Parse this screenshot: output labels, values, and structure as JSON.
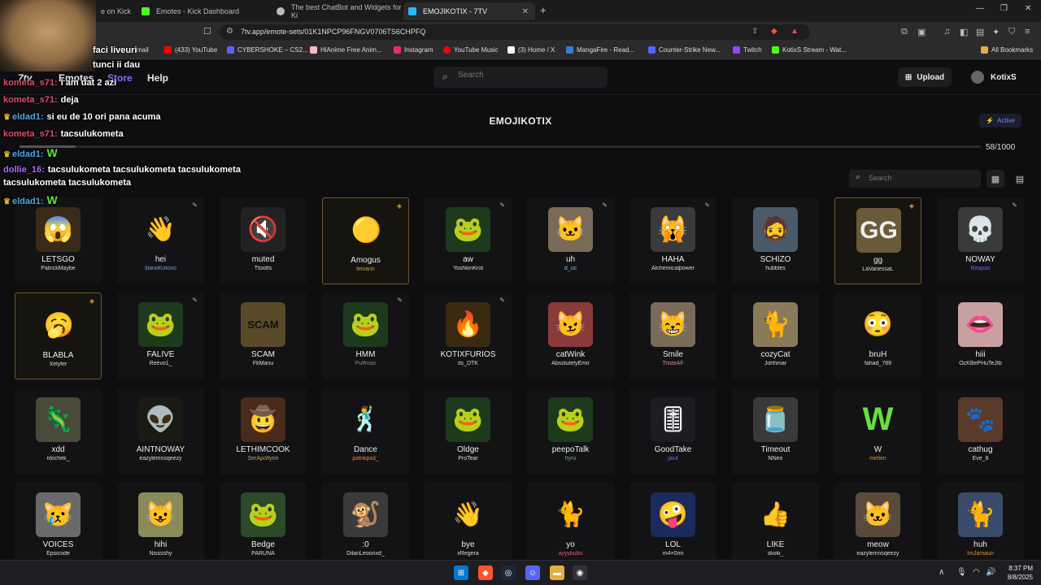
{
  "tabs": [
    {
      "label": "e on Kick",
      "color": "#53fc18"
    },
    {
      "label": "Emotes - Kick Dashboard",
      "color": "#53fc18"
    },
    {
      "label": "The best ChatBot and Widgets for Ki",
      "color": "#bbbbbb"
    },
    {
      "label": "EMOJIKOTIX - 7TV",
      "color": "#29b6f6"
    }
  ],
  "url": "7tv.app/emote-sets/01K1NPCP96FNGV0706TS6CHPFQ",
  "bookmarks": [
    {
      "label": "mail",
      "color": "#888888"
    },
    {
      "label": "(433) YouTube",
      "color": "#ff0000"
    },
    {
      "label": "CYBERSHOKE – CS2...",
      "color": "#5865f2"
    },
    {
      "label": "HiAnime Free Anim...",
      "color": "#ffb6c1"
    },
    {
      "label": "Instagram",
      "color": "#e1306c"
    },
    {
      "label": "YouTube Music",
      "color": "#ff0000"
    },
    {
      "label": "(3) Home / X",
      "color": "#ffffff"
    },
    {
      "label": "MangaFire - Read...",
      "color": "#3a7bd5"
    },
    {
      "label": "Counter-Strike New...",
      "color": "#4b69ff"
    },
    {
      "label": "Twitch",
      "color": "#9146ff"
    },
    {
      "label": "KotixS Stream - Wat...",
      "color": "#53fc18"
    }
  ],
  "all_bookmarks": "All Bookmarks",
  "nav": {
    "logo": "7tv",
    "emotes": "Emotes",
    "store": "Store",
    "help": "Help",
    "search_placeholder": "Search",
    "upload": "Upload",
    "username": "KotixS"
  },
  "set": {
    "title": "EMOJIKOTIX",
    "status": "Active",
    "count": "58/1000",
    "fill_fraction": 0.058,
    "search_placeholder": "Search"
  },
  "emotes": [
    {
      "name": "LETSGO",
      "author": "PatrickMaybe",
      "author_color": "#dddddd",
      "bg": "#3a2a1a",
      "glyph": "😱",
      "highlight": false,
      "badge": ""
    },
    {
      "name": "hei",
      "author": "IlianoKokoro",
      "author_color": "#6ea8d8",
      "bg": "#131315",
      "glyph": "👋",
      "highlight": false,
      "badge": "✎"
    },
    {
      "name": "muted",
      "author": "Ttootts",
      "author_color": "#dddddd",
      "bg": "#222222",
      "glyph": "🔇",
      "highlight": false,
      "badge": ""
    },
    {
      "name": "Amogus",
      "author": "telvann",
      "author_color": "#c9a24a",
      "bg": "#15140f",
      "glyph": "🟡",
      "highlight": true,
      "badge": "◈"
    },
    {
      "name": "aw",
      "author": "YoshkinKrot",
      "author_color": "#dddddd",
      "bg": "#1d3a1d",
      "glyph": "🐸",
      "highlight": false,
      "badge": "✎"
    },
    {
      "name": "uh",
      "author": "d_uc",
      "author_color": "#7cc0e8",
      "bg": "#7a6a5a",
      "glyph": "🐱",
      "highlight": false,
      "badge": "✎"
    },
    {
      "name": "HAHA",
      "author": "Alchemicalpower",
      "author_color": "#dddddd",
      "bg": "#3a3a3a",
      "glyph": "🙀",
      "highlight": false,
      "badge": "✎"
    },
    {
      "name": "SCHIZO",
      "author": "hubbles",
      "author_color": "#dddddd",
      "bg": "#4a5a6a",
      "glyph": "🧔",
      "highlight": false,
      "badge": ""
    },
    {
      "name": "gg",
      "author": "LaVanessaL",
      "author_color": "#dddddd",
      "bg": "#6a5a3a",
      "glyph": "GG",
      "highlight": true,
      "badge": "◈"
    },
    {
      "name": "NOWAY",
      "author": "Reapax",
      "author_color": "#7a5cff",
      "bg": "#3a3a3a",
      "glyph": "💀",
      "highlight": false,
      "badge": "✎"
    },
    {
      "name": "BLABLA",
      "author": "Xelyfer",
      "author_color": "#dddddd",
      "bg": "#15140f",
      "glyph": "🥱",
      "highlight": true,
      "badge": "◈"
    },
    {
      "name": "FALIVE",
      "author": "Reevo1_",
      "author_color": "#dddddd",
      "bg": "#1d3a1d",
      "glyph": "🐸",
      "highlight": false,
      "badge": "✎"
    },
    {
      "name": "SCAM",
      "author": "FkManu",
      "author_color": "#dddddd",
      "bg": "#5a4a2a",
      "glyph": "SCAM",
      "highlight": false,
      "badge": ""
    },
    {
      "name": "HMM",
      "author": "Puffmax",
      "author_color": "#8a8a8a",
      "bg": "#1d3a1d",
      "glyph": "🐸",
      "highlight": false,
      "badge": "✎"
    },
    {
      "name": "KOTIXFURIOS",
      "author": "its_DTK",
      "author_color": "#dddddd",
      "bg": "#3a2a10",
      "glyph": "🔥",
      "highlight": false,
      "badge": "✎"
    },
    {
      "name": "catWink",
      "author": "AbsolutelyEmir",
      "author_color": "#dddddd",
      "bg": "#8a3a3a",
      "glyph": "😼",
      "highlight": false,
      "badge": ""
    },
    {
      "name": "Smile",
      "author": "TristeAF",
      "author_color": "#d88a8a",
      "bg": "#7a6a5a",
      "glyph": "😸",
      "highlight": false,
      "badge": ""
    },
    {
      "name": "cozyCat",
      "author": "Johhmar",
      "author_color": "#dddddd",
      "bg": "#8a7a5a",
      "glyph": "🐈",
      "highlight": false,
      "badge": ""
    },
    {
      "name": "bruH",
      "author": "fahad_789",
      "author_color": "#dddddd",
      "bg": "#131315",
      "glyph": "😳",
      "highlight": false,
      "badge": ""
    },
    {
      "name": "hiii",
      "author": "OcKBePHuTeJIb",
      "author_color": "#dddddd",
      "bg": "#c9a0a0",
      "glyph": "👄",
      "highlight": false,
      "badge": ""
    },
    {
      "name": "xdd",
      "author": "nlochek_",
      "author_color": "#dddddd",
      "bg": "#4a4a3a",
      "glyph": "🦎",
      "highlight": false,
      "badge": ""
    },
    {
      "name": "AINTNOWAY",
      "author": "eazylemnsqeezy",
      "author_color": "#dddddd",
      "bg": "#1a1a14",
      "glyph": "👽",
      "highlight": false,
      "badge": ""
    },
    {
      "name": "LETHIMCOOK",
      "author": "SerApollyon",
      "author_color": "#c9a070",
      "bg": "#4a2a1a",
      "glyph": "🤠",
      "highlight": false,
      "badge": ""
    },
    {
      "name": "Dance",
      "author": "patrikpxd_",
      "author_color": "#e08a3a",
      "bg": "#131315",
      "glyph": "🕺",
      "highlight": false,
      "badge": ""
    },
    {
      "name": "Oldge",
      "author": "ProTear",
      "author_color": "#dddddd",
      "bg": "#1d3a1d",
      "glyph": "🐸",
      "highlight": false,
      "badge": ""
    },
    {
      "name": "peepoTalk",
      "author": "hyru",
      "author_color": "#4fc08a",
      "bg": "#1d3a1d",
      "glyph": "🐸",
      "highlight": false,
      "badge": ""
    },
    {
      "name": "GoodTake",
      "author": "jaiul",
      "author_color": "#7a5cff",
      "bg": "#1c1c22",
      "glyph": "🎚",
      "highlight": false,
      "badge": ""
    },
    {
      "name": "Timeout",
      "author": "NNeo",
      "author_color": "#dddddd",
      "bg": "#3a3a3a",
      "glyph": "🫙",
      "highlight": false,
      "badge": ""
    },
    {
      "name": "W",
      "author": "mellen",
      "author_color": "#e0902a",
      "bg": "#131315",
      "glyph": "W",
      "highlight": false,
      "badge": ""
    },
    {
      "name": "cathug",
      "author": "Eve_8",
      "author_color": "#dddddd",
      "bg": "#5a3a2a",
      "glyph": "🐾",
      "highlight": false,
      "badge": ""
    },
    {
      "name": "VOICES",
      "author": "Epsicode",
      "author_color": "#dddddd",
      "bg": "#6a6a6a",
      "glyph": "😿",
      "highlight": false,
      "badge": ""
    },
    {
      "name": "hihi",
      "author": "Nisssshy",
      "author_color": "#dddddd",
      "bg": "#8a8a5a",
      "glyph": "😺",
      "highlight": false,
      "badge": ""
    },
    {
      "name": "Bedge",
      "author": "PARUNA",
      "author_color": "#dddddd",
      "bg": "#2a4a2a",
      "glyph": "🐸",
      "highlight": false,
      "badge": ""
    },
    {
      "name": ":0",
      "author": "DilanLeoonxd_",
      "author_color": "#dddddd",
      "bg": "#3a3a3a",
      "glyph": "🐒",
      "highlight": false,
      "badge": ""
    },
    {
      "name": "bye",
      "author": "xRegera",
      "author_color": "#dddddd",
      "bg": "#131315",
      "glyph": "👋",
      "highlight": false,
      "badge": ""
    },
    {
      "name": "yo",
      "author": "ayyybubu",
      "author_color": "#e05a8a",
      "bg": "#131315",
      "glyph": "🐈",
      "highlight": false,
      "badge": ""
    },
    {
      "name": "LOL",
      "author": "m4×0nn",
      "author_color": "#dddddd",
      "bg": "#1a2a5a",
      "glyph": "🤪",
      "highlight": false,
      "badge": ""
    },
    {
      "name": "LIKE",
      "author": "skoki_",
      "author_color": "#dddddd",
      "bg": "#131315",
      "glyph": "👍",
      "highlight": false,
      "badge": ""
    },
    {
      "name": "meow",
      "author": "eazylemnsqeezy",
      "author_color": "#dddddd",
      "bg": "#5a4a3a",
      "glyph": "🐱",
      "highlight": false,
      "badge": ""
    },
    {
      "name": "huh",
      "author": "ImJamaun",
      "author_color": "#e0902a",
      "bg": "#3a4a6a",
      "glyph": "🐈",
      "highlight": false,
      "badge": ""
    }
  ],
  "chat": [
    {
      "nick": "",
      "nick_color": "#ffffff",
      "text": "faci liveuri",
      "crown": false
    },
    {
      "nick": "",
      "nick_color": "#ffffff",
      "text": "tunci ii dau",
      "crown": false
    },
    {
      "nick": "kometa_s71:",
      "nick_color": "#e0506a",
      "text": "i am dat 2 azi",
      "crown": false
    },
    {
      "nick": "kometa_s71:",
      "nick_color": "#e0506a",
      "text": "deja",
      "crown": false
    },
    {
      "nick": "eldad1:",
      "nick_color": "#4fa8e0",
      "text": "si eu de 10 ori pana acuma",
      "crown": true
    },
    {
      "nick": "kometa_s71:",
      "nick_color": "#e0506a",
      "text": "tacsulukometa",
      "crown": false
    },
    {
      "nick": "eldad1:",
      "nick_color": "#4fa8e0",
      "text": "W",
      "crown": true
    },
    {
      "nick": "dollie_16:",
      "nick_color": "#b06aff",
      "text": "tacsulukometa tacsulukometa tacsulukometa tacsulukometa tacsulukometa",
      "crown": false
    },
    {
      "nick": "eldad1:",
      "nick_color": "#4fa8e0",
      "text": "W",
      "crown": true
    }
  ],
  "taskbar": {
    "time": "8:37 PM",
    "date": "8/8/2025"
  }
}
